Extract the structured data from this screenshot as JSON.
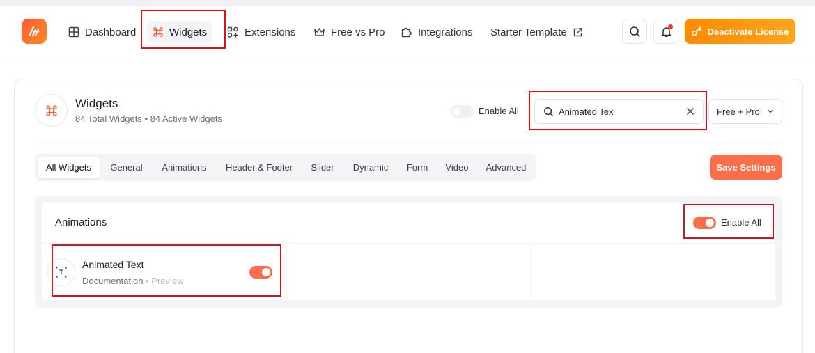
{
  "nav": {
    "items": [
      {
        "label": "Dashboard",
        "icon": "grid-icon"
      },
      {
        "label": "Widgets",
        "icon": "command-icon"
      },
      {
        "label": "Extensions",
        "icon": "extensions-icon"
      },
      {
        "label": "Free vs Pro",
        "icon": "crown-icon"
      },
      {
        "label": "Integrations",
        "icon": "puzzle-icon"
      },
      {
        "label": "Starter Template",
        "icon": "external-link-icon"
      }
    ],
    "license_label": "Deactivate License"
  },
  "header": {
    "title": "Widgets",
    "subtitle": "84 Total Widgets • 84 Active Widgets",
    "enable_all_label": "Enable All",
    "enable_all_on": false
  },
  "search": {
    "value": "Animated Tex"
  },
  "filter": {
    "selected": "Free + Pro"
  },
  "tabs": [
    "All Widgets",
    "General",
    "Animations",
    "Header & Footer",
    "Slider",
    "Dynamic",
    "Form",
    "Video",
    "Advanced"
  ],
  "save_label": "Save Settings",
  "section": {
    "title": "Animations",
    "enable_all_label": "Enable All",
    "enable_all_on": true,
    "widgets": [
      {
        "name": "Animated Text",
        "doc_label": "Documentation",
        "separator": "•",
        "preview_label": "Preview",
        "enabled": true
      }
    ]
  },
  "colors": {
    "accent": "#ff6e4a",
    "license_gradient": [
      "#ff8a00",
      "#ffa51c"
    ],
    "highlight": "#e0101a"
  }
}
